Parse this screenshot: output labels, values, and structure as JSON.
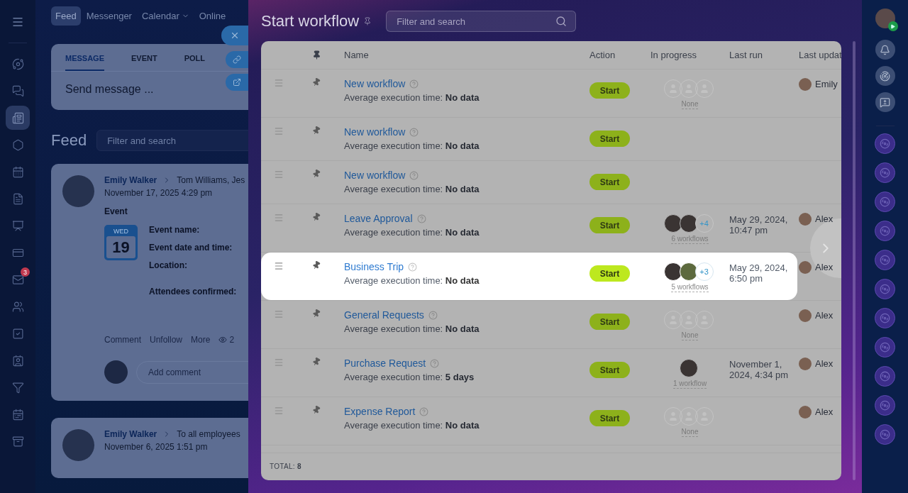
{
  "sidebar": {
    "items": [
      {
        "selected": false
      },
      {
        "selected": false
      },
      {
        "selected": true
      },
      {
        "selected": false
      },
      {
        "selected": false
      },
      {
        "selected": false
      },
      {
        "selected": false
      },
      {
        "selected": false
      },
      {
        "selected": false,
        "badge": "3"
      },
      {
        "selected": false
      },
      {
        "selected": false
      },
      {
        "selected": false
      },
      {
        "selected": false
      },
      {
        "selected": false
      },
      {
        "selected": false
      }
    ]
  },
  "top_nav": [
    {
      "label": "Feed",
      "selected": true,
      "has_menu": false
    },
    {
      "label": "Messenger",
      "selected": false,
      "has_menu": false
    },
    {
      "label": "Calendar",
      "selected": false,
      "has_menu": true
    },
    {
      "label": "Online",
      "selected": false,
      "has_menu": false
    }
  ],
  "composer": {
    "tabs": [
      {
        "label": "MESSAGE",
        "selected": true
      },
      {
        "label": "EVENT",
        "selected": false
      },
      {
        "label": "POLL",
        "selected": false
      }
    ],
    "placeholder": "Send message ..."
  },
  "feed": {
    "title": "Feed",
    "search_placeholder": "Filter and search",
    "posts": [
      {
        "kind": "event",
        "author": "Emily Walker",
        "recipients": "Tom Williams, Jes",
        "date": "November 17, 2025 4:29 pm",
        "event": {
          "heading": "Event",
          "weekday": "WED",
          "day": "19",
          "fields": [
            "Event name:",
            "Event date and time:",
            "Location:",
            "Attendees confirmed:"
          ]
        },
        "actions": [
          "Comment",
          "Unfollow",
          "More"
        ],
        "views": "2",
        "comment_placeholder": "Add comment"
      },
      {
        "kind": "message",
        "author": "Emily Walker",
        "recipients": "To all employees",
        "date": "November 6, 2025 1:51 pm"
      }
    ]
  },
  "slider": {
    "title": "Start workflow",
    "search_placeholder": "Filter and search",
    "columns": [
      "Name",
      "Action",
      "In progress",
      "Last run",
      "Last updat"
    ],
    "rows": [
      {
        "name": "New workflow",
        "avg": "Average execution time: **No data**",
        "action": "Start",
        "progress": {
          "kind": "placeholders",
          "label": "None"
        },
        "updated_by": "Emily",
        "highlighted": false
      },
      {
        "name": "New workflow",
        "avg": "Average execution time: **No data**",
        "action": "Start",
        "highlighted": false
      },
      {
        "name": "New workflow",
        "avg": "Average execution time: **No data**",
        "action": "Start",
        "highlighted": false
      },
      {
        "name": "Leave Approval",
        "avg": "Average execution time: **No data**",
        "action": "Start",
        "progress": {
          "kind": "group",
          "count": "+4",
          "label": "6 workflows"
        },
        "last_run": "May 29, 2024, 10:47 pm",
        "updated_by": "Alex",
        "highlighted": false
      },
      {
        "name": "Business Trip",
        "avg": "Average execution time: **No data**",
        "action": "Start",
        "progress": {
          "kind": "group",
          "count": "+3",
          "label": "5 workflows"
        },
        "last_run": "May 29, 2024, 6:50 pm",
        "updated_by": "Alex",
        "highlighted": true
      },
      {
        "name": "General Requests",
        "avg": "Average execution time: **No data**",
        "action": "Start",
        "progress": {
          "kind": "placeholders",
          "label": "None"
        },
        "updated_by": "Alex",
        "highlighted": false
      },
      {
        "name": "Purchase Request",
        "avg": "Average execution time: **5 days**",
        "action": "Start",
        "progress": {
          "kind": "single",
          "label": "1 workflow"
        },
        "last_run": "November 1, 2024, 4:34 pm",
        "updated_by": "Alex",
        "highlighted": false
      },
      {
        "name": "Expense Report",
        "avg": "Average execution time: **No data**",
        "action": "Start",
        "progress": {
          "kind": "placeholders",
          "label": "None"
        },
        "updated_by": "Alex",
        "highlighted": false
      }
    ],
    "total": "TOTAL: **8**"
  }
}
